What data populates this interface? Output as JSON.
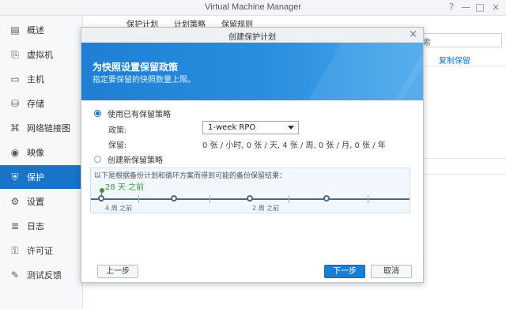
{
  "window": {
    "title": "Virtual Machine Manager"
  },
  "window_controls": {
    "help": "?",
    "minimize": "—",
    "maximize": "□",
    "close": "×"
  },
  "sidebar": {
    "items": [
      {
        "label": "概述",
        "icon": "overview-icon",
        "glyph": "▤"
      },
      {
        "label": "虚拟机",
        "icon": "vm-icon",
        "glyph": "⎘"
      },
      {
        "label": "主机",
        "icon": "host-icon",
        "glyph": "▭"
      },
      {
        "label": "存储",
        "icon": "storage-icon",
        "glyph": "⛁"
      },
      {
        "label": "网络链接图",
        "icon": "network-icon",
        "glyph": "⌘"
      },
      {
        "label": "映像",
        "icon": "image-icon",
        "glyph": "◉"
      },
      {
        "label": "保护",
        "icon": "protection-icon",
        "glyph": "⛨",
        "active": true
      },
      {
        "label": "设置",
        "icon": "settings-icon",
        "glyph": "⚙"
      },
      {
        "label": "日志",
        "icon": "log-icon",
        "glyph": "≣"
      },
      {
        "label": "许可证",
        "icon": "license-icon",
        "glyph": "⚿"
      },
      {
        "label": "测试反馈",
        "icon": "feedback-icon",
        "glyph": "✎"
      }
    ]
  },
  "background": {
    "tabs": [
      "保护计划",
      "计划策略",
      "保留规则"
    ],
    "search_placeholder": "搜索",
    "column": "复制保留"
  },
  "modal": {
    "title": "创建保护计划",
    "close_glyph": "×",
    "banner_title": "为快照设置保留政策",
    "banner_subtitle": "指定要保留的快照数量上限。",
    "option_existing": "使用已有保留策略",
    "policy_label": "政策:",
    "policy_value": "1-week RPO",
    "retention_label": "保留:",
    "retention_value": "0 张 / 小时, 0 张 / 天, 4 张 / 周, 0 张 / 月, 0 张 / 年",
    "option_new": "创建新保留策略",
    "timeline_desc": "以下是根据备份计划和循环方案而得到可能的备份保留结果：",
    "timeline_point": "28 天 之前",
    "timeline_labels": [
      "4 周 之前",
      "2 周 之前"
    ],
    "prev_button": "上一步",
    "next_button": "下一步",
    "cancel_button": "取消"
  },
  "colors": {
    "accent": "#1774c8",
    "green": "#3a9a3a"
  }
}
